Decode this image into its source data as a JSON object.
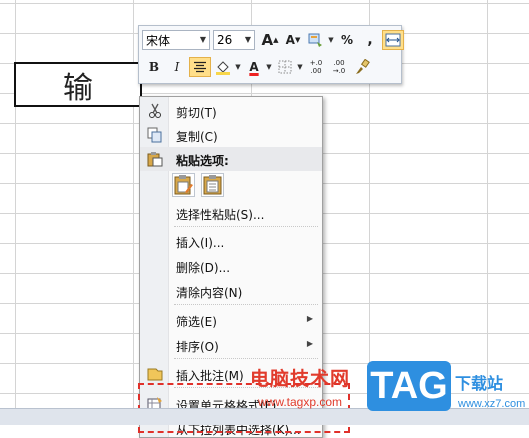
{
  "cell": {
    "text": "输"
  },
  "mini_toolbar": {
    "font_name": "宋体",
    "font_size": "26",
    "grow_font": "A",
    "shrink_font": "A",
    "percent": "%",
    "comma": ",",
    "bold": "B",
    "italic": "I",
    "font_color_letter": "A",
    "inc_decimal_top": "+.0",
    "inc_decimal_bottom": ".00",
    "dec_decimal_top": ".00",
    "dec_decimal_bottom": "→.0"
  },
  "context_menu": {
    "items": [
      {
        "label": "剪切(T)",
        "icon": "scissors-icon"
      },
      {
        "label": "复制(C)",
        "icon": "copy-icon"
      },
      {
        "label": "粘贴选项:",
        "icon": "paste-icon"
      },
      {
        "label": "选择性粘贴(S)...",
        "icon": ""
      },
      {
        "label": "插入(I)...",
        "icon": ""
      },
      {
        "label": "删除(D)...",
        "icon": ""
      },
      {
        "label": "清除内容(N)",
        "icon": ""
      },
      {
        "label": "筛选(E)",
        "icon": "",
        "submenu": true
      },
      {
        "label": "排序(O)",
        "icon": "",
        "submenu": true
      },
      {
        "label": "插入批注(M)",
        "icon": "comment-icon"
      },
      {
        "label": "设置单元格格式(F)...",
        "icon": "format-cells-icon"
      },
      {
        "label": "从下拉列表中选择(K)...",
        "icon": ""
      }
    ]
  },
  "watermark": {
    "cn_text": "电脑技术网",
    "url": "www.tagxp.com",
    "tag": "TAG",
    "download": "下载站",
    "site": "www.xz7.com"
  },
  "colors": {
    "highlight": "#e0302a",
    "tag_blue": "#2e8fe0",
    "selected_button": "#ffdf8a"
  }
}
